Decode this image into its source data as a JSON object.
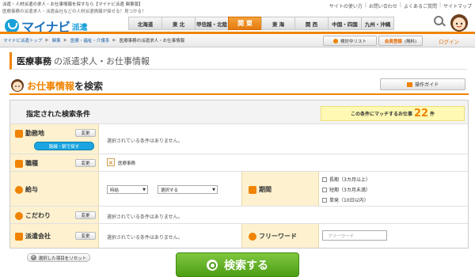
{
  "top": {
    "line1": "派遣・人材派遣の求人・お仕事情報を探すなら【マイナビ派遣 関東版】",
    "line2": "医療事務の派遣求人・派遣会社などの人材派遣情報が探せる！見つかる！",
    "links": [
      "サイトの使い方",
      "お問い合わせ",
      "よくあるご質問",
      "サイトマップ"
    ]
  },
  "logo": {
    "text": "マイナビ",
    "sub": "派遣"
  },
  "regions": [
    {
      "label": "北海道",
      "active": false
    },
    {
      "label": "東 北",
      "active": false
    },
    {
      "label": "甲信越・北陸",
      "active": false
    },
    {
      "label": "関 東",
      "active": true
    },
    {
      "label": "東 海",
      "active": false
    },
    {
      "label": "関 西",
      "active": false
    },
    {
      "label": "中国・四国",
      "active": false
    },
    {
      "label": "九州・沖縄",
      "active": false
    }
  ],
  "breadcrumb": [
    "マイナビ派遣トップ",
    "関東",
    "医療・福祉・介護系",
    "医療事務の派遣求人・お仕事情報"
  ],
  "bar": {
    "list": "検討中リスト",
    "register": "会員登録",
    "register_small": "(無料)",
    "login": "ログイン"
  },
  "page_title": {
    "bold": "医療事務",
    "rest": "の派遣求人・お仕事情報"
  },
  "section": {
    "title_accent": "お仕事情報",
    "title_rest": "を検索",
    "guide": "操作ガイド"
  },
  "conditions": {
    "title": "指定された検索条件",
    "match_text": "この条件にマッチするお仕事",
    "match_count": "22",
    "match_unit": "件",
    "change": "変更",
    "none": "選択されている条件はありません。",
    "location": {
      "label": "勤務地",
      "station_btn": "路線・駅で探す"
    },
    "occupation": {
      "label": "職種",
      "value": "医療事務"
    },
    "salary": {
      "label": "給与",
      "type": "時給",
      "amount": "選択する"
    },
    "period": {
      "label": "期間",
      "options": [
        "長期（3カ月以上）",
        "短期（3カ月未満）",
        "単発（10日以内）"
      ]
    },
    "kodawari": {
      "label": "こだわり"
    },
    "agency": {
      "label": "派遣会社"
    },
    "freeword": {
      "label": "フリーワード",
      "placeholder": "フリーワード"
    }
  },
  "reset": "選択した項目をリセット",
  "search_button": "検索する"
}
